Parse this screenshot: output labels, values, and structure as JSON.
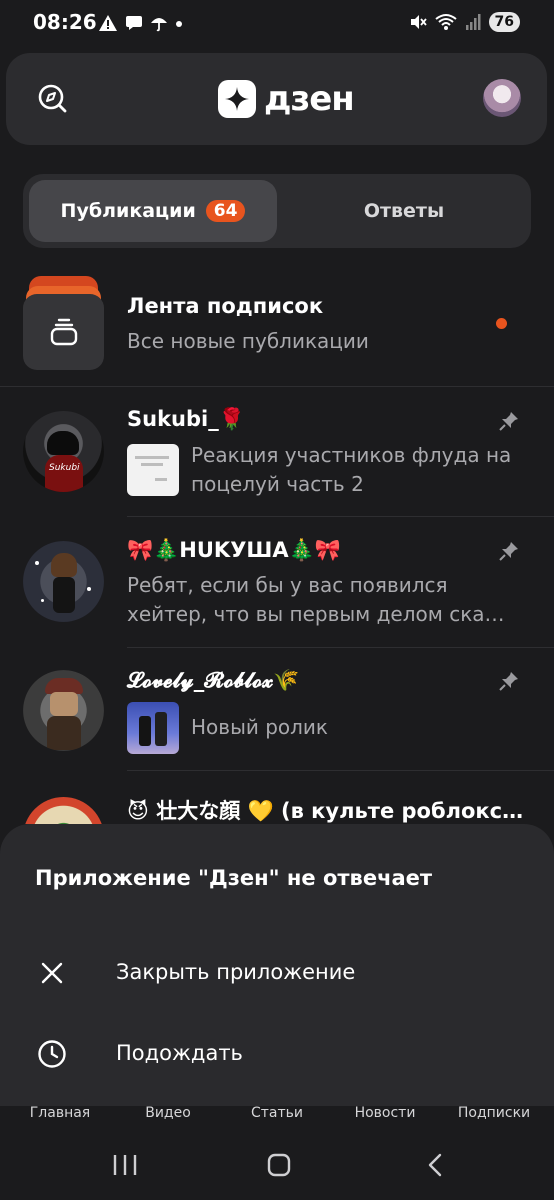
{
  "status_bar": {
    "time": "08:26",
    "battery": "76"
  },
  "header": {
    "logo_text": "дзен",
    "search_icon": "search-compass-icon"
  },
  "tabs": {
    "publications_label": "Публикации",
    "publications_count": "64",
    "answers_label": "Ответы"
  },
  "feed": {
    "subscriptions": {
      "title": "Лента подписок",
      "subtitle": "Все новые публикации"
    },
    "items": [
      {
        "title": "Sukubi_🌹",
        "text": "Реакция участников флуда на поцелуй часть 2",
        "pinned": true
      },
      {
        "title": "🎀🎄HUKУШA🎄🎀",
        "text": "Ребят, если бы у вас появился хейтер, что вы  первым делом ска…",
        "pinned": true
      },
      {
        "title": "𝓛𝓸𝓿𝓮𝓵𝔂_𝓡𝓸𝓫𝓵𝓸𝔁🌾",
        "text": "Новый ролик",
        "pinned": true
      },
      {
        "title": "😈 壮大な顔 💛 (в культе роблоксер…"
      }
    ],
    "avatar_label": "Sukubi"
  },
  "dialog": {
    "title": "Приложение \"Дзен\" не отвечает",
    "close_label": "Закрыть приложение",
    "wait_label": "Подождать"
  },
  "bottom_nav": [
    "Главная",
    "Видео",
    "Статьи",
    "Новости",
    "Подписки"
  ],
  "colors": {
    "accent": "#e8541e",
    "background": "#1b1b1d",
    "surface": "#2c2c2f"
  }
}
